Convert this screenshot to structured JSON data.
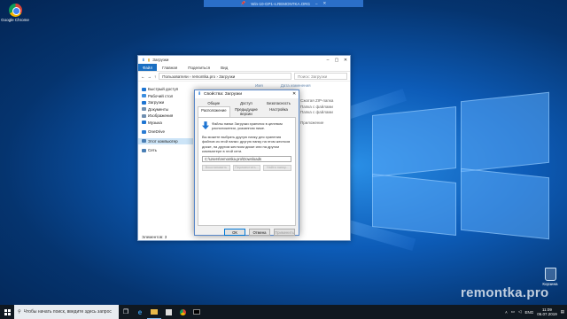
{
  "rdp_bar": {
    "title": "Win-10-GP1-s.REMONTKA.ORG"
  },
  "desktop": {
    "icons": [
      {
        "label": "Google Chrome"
      },
      {
        "label": "Корзина"
      }
    ],
    "watermark": "remontka.pro"
  },
  "explorer": {
    "title": "Загрузки",
    "ribbon": {
      "file": "Файл",
      "tabs": [
        "Главная",
        "Поделиться",
        "Вид"
      ]
    },
    "address": {
      "path": "Пользователи › remontka.pro › Загрузки",
      "search_placeholder": "Поиск: Загрузки"
    },
    "nav": [
      {
        "label": "Быстрый доступ",
        "icon": "star-icon",
        "color": "#1e75d2"
      },
      {
        "label": "Рабочий стол",
        "icon": "folder-icon",
        "color": "#3b8ee0"
      },
      {
        "label": "Загрузки",
        "icon": "download-icon",
        "color": "#1e75d2"
      },
      {
        "label": "Документы",
        "icon": "folder-icon",
        "color": "#6f8fb0"
      },
      {
        "label": "Изображения",
        "icon": "folder-icon",
        "color": "#6f8fb0"
      },
      {
        "label": "Музыка",
        "icon": "music-icon",
        "color": "#1e75d2"
      },
      {
        "label": "OneDrive",
        "icon": "cloud-icon",
        "color": "#2b7cd3"
      },
      {
        "label": "Этот компьютер",
        "icon": "computer-icon",
        "color": "#4a7fb5"
      },
      {
        "label": "Сеть",
        "icon": "network-icon",
        "color": "#4a7fb5"
      }
    ],
    "columns": [
      "Имя",
      "Дата изменения"
    ],
    "details": [
      "Сжатая ZIP-папка",
      "Папка с файлами",
      "Папка с файлами",
      "Приложение"
    ],
    "status": "Элементов: 3"
  },
  "dialog": {
    "title": "Свойства: Загрузки",
    "close": "✕",
    "tabs": [
      "Общие",
      "Доступ",
      "Безопасность",
      "Расположение",
      "Предыдущие версии",
      "Настройка"
    ],
    "intro": "Файлы папки Загрузки хранятся в целевом расположении, указанном ниже.",
    "body": "Вы можете выбрать другую папку для хранения файлов из этой папки: другую папку на этом жестком диске, на другом жестком диске или на другом компьютере в этой сети.",
    "path_value": "C:\\Users\\remontka.pro\\Downloads",
    "actions": [
      "Восстановить",
      "Переместить...",
      "Найти папку..."
    ],
    "buttons": {
      "ok": "ОК",
      "cancel": "Отмена",
      "apply": "Применить"
    }
  },
  "taskbar": {
    "search_placeholder": "Чтобы начать поиск, введите здесь запрос",
    "lang": "ENG",
    "time": "11:09",
    "date": "06.07.2019"
  }
}
